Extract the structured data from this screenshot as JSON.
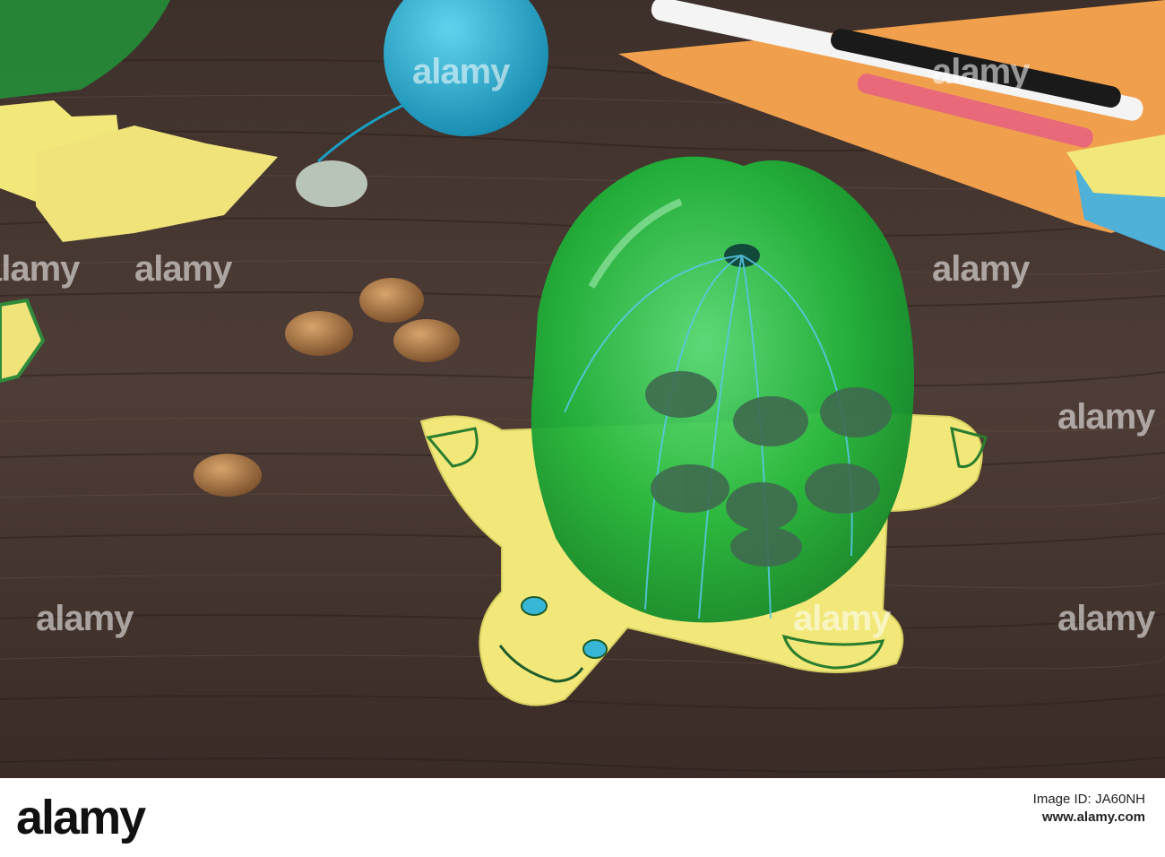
{
  "watermarks": [
    {
      "text": "alamy"
    },
    {
      "text": "alamy"
    },
    {
      "text": "alamy"
    },
    {
      "text": "alamy"
    },
    {
      "text": "alamy"
    },
    {
      "text": "alamy"
    },
    {
      "text": "alamy"
    },
    {
      "text": "alamy"
    },
    {
      "text": "alamy"
    }
  ],
  "footer": {
    "logo_text": "alamy",
    "image_id_label": "Image ID:",
    "image_id": "JA60NH",
    "url": "www.alamy.com"
  },
  "colors": {
    "wood": "#4a3a33",
    "turtle_green": "#2fbf3f",
    "sponge_yellow": "#f2e87a",
    "yarn_blue": "#22a6c8",
    "felt_orange": "#f29a4a"
  }
}
